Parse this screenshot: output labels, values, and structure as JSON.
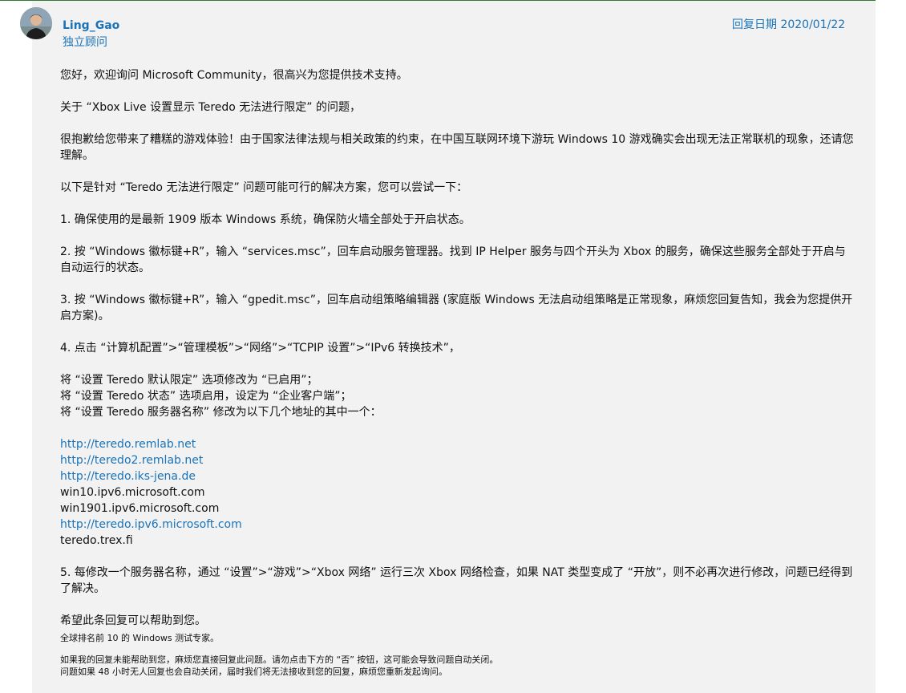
{
  "author": {
    "name": "Ling_Gao",
    "title": "独立顾问"
  },
  "reply": {
    "date": "回复日期 2020/01/22"
  },
  "body": {
    "greeting": "您好，欢迎询问 Microsoft Community，很高兴为您提供技术支持。",
    "about": "关于 “Xbox Live 设置显示 Teredo 无法进行限定” 的问题，",
    "apology": "很抱歉给您带来了糟糕的游戏体验！由于国家法律法规与相关政策的约束，在中国互联网环境下游玩 Windows 10 游戏确实会出现无法正常联机的现象，还请您理解。",
    "intro": "以下是针对 “Teredo 无法进行限定” 问题可能可行的解决方案，您可以尝试一下：",
    "step1": "1. 确保使用的是最新 1909 版本 Windows 系统，确保防火墙全部处于开启状态。",
    "step2": "2. 按 “Windows 徽标键+R”，输入 “services.msc”，回车启动服务管理器。找到 IP Helper 服务与四个开头为 Xbox 的服务，确保这些服务全部处于开启与自动运行的状态。",
    "step3": "3. 按 “Windows 徽标键+R”，输入 “gpedit.msc”，回车启动组策略编辑器 (家庭版 Windows 无法启动组策略是正常现象，麻烦您回复告知，我会为您提供开启方案)。",
    "step4": "4. 点击 “计算机配置”>“管理模板”>“网络”>“TCPIP 设置”>“IPv6 转换技术”，",
    "setting1": "将 “设置 Teredo 默认限定” 选项修改为 “已启用”；",
    "setting2": "将 “设置 Teredo 状态” 选项启用，设定为 “企业客户端”；",
    "setting3": "将 “设置 Teredo 服务器名称” 修改为以下几个地址的其中一个：",
    "servers": [
      "http://teredo.remlab.net",
      "http://teredo2.remlab.net",
      "http://teredo.iks-jena.de",
      "win10.ipv6.microsoft.com",
      "win1901.ipv6.microsoft.com",
      "http://teredo.ipv6.microsoft.com",
      "teredo.trex.fi"
    ],
    "step5": "5. 每修改一个服务器名称，通过 “设置”>“游戏”>“Xbox 网络” 运行三次 Xbox 网络检查，如果 NAT 类型变成了 “开放”，则不必再次进行修改，问题已经得到了解决。",
    "closing": "希望此条回复可以帮助到您。",
    "signature": "全球排名前 10 的 Windows 测试专家。",
    "note1": "如果我的回复未能帮助到您，麻烦您直接回复此问题。请勿点击下方的 “否” 按钮，这可能会导致问题自动关闭。",
    "note2": "问题如果 48 小时无人回复也会自动关闭，届时我们将无法接收到您的回复，麻烦您重新发起询问。"
  },
  "colors": {
    "link": "#1a73b8",
    "background": "#f2f2f2",
    "top_border": "#2e7d32"
  }
}
